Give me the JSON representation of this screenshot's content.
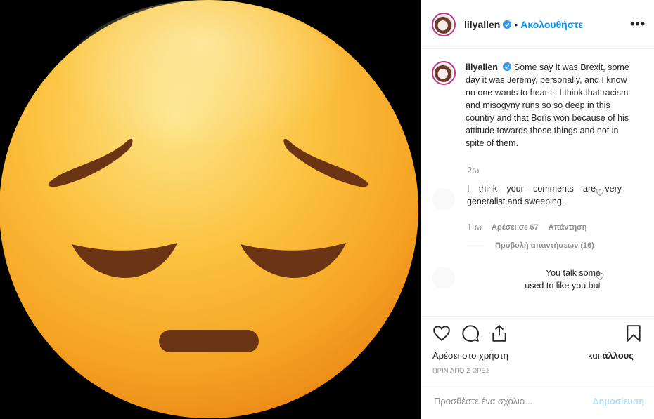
{
  "header": {
    "username": "lilyallen",
    "separator": "•",
    "follow_label": "Ακολουθήστε",
    "more_label": "•••"
  },
  "caption": {
    "username": "lilyallen",
    "text": "Some say it was Brexit, some day it was Jeremy, personally, and I know no one wants to hear it, I think that racism and misogyny runs so so deep in this country and that Boris won because of his attitude towards those things and not in spite of them.",
    "time": "2ω"
  },
  "comments": [
    {
      "text": "I think your comments are very generalist and sweeping.",
      "time": "1 ω",
      "likes": "Αρέσει σε 67",
      "reply": "Απάντηση",
      "view_replies": "Προβολή απαντήσεων (16)"
    },
    {
      "text_line1": "You talk some",
      "text_line2": "used to like you but"
    }
  ],
  "actions": {
    "liked_by": "Αρέσει στο χρήστη",
    "and_others_prefix": "και",
    "and_others_bold": "άλλους",
    "timestamp": "ΠΡΙΝ ΑΠΟ 2 ΩΡΕΣ"
  },
  "add_comment": {
    "placeholder": "Προσθέστε ένα σχόλιο...",
    "post_label": "Δημοσίευση"
  },
  "colors": {
    "accent": "#0095f6",
    "post_disabled": "#b2dffc",
    "muted": "#8e8e8e",
    "emoji_face": "#fbbf3b",
    "emoji_features": "#6b3414"
  },
  "icons": {
    "verified": "verified-badge-icon",
    "heart": "heart-icon",
    "comment": "comment-icon",
    "share": "share-icon",
    "save": "bookmark-icon"
  }
}
